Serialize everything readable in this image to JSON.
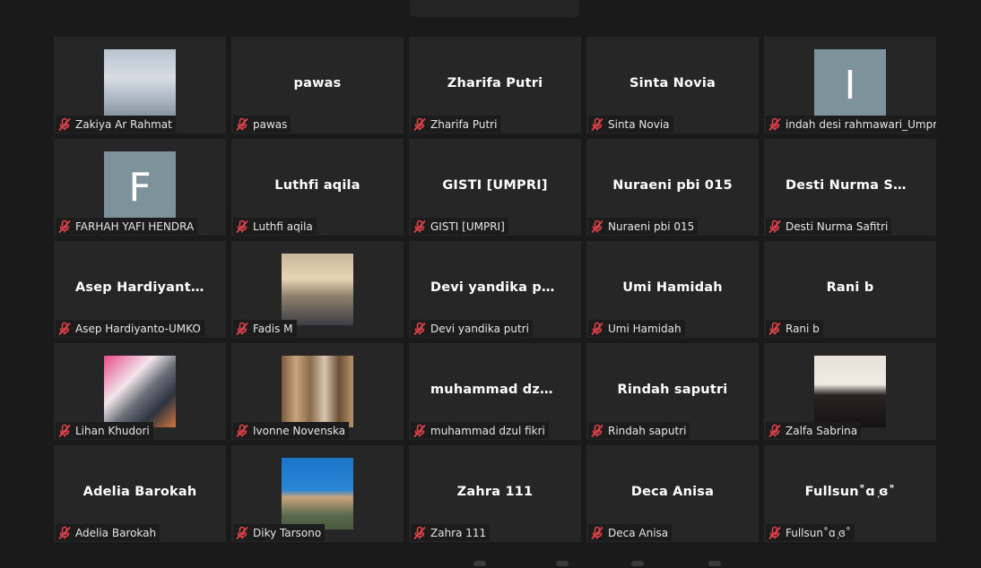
{
  "meeting": {
    "tiles": [
      {
        "display": "",
        "label": "Zakiya Ar Rahmat",
        "avatar": "photo",
        "photo": "sky"
      },
      {
        "display": "pawas",
        "label": "pawas",
        "avatar": "name"
      },
      {
        "display": "Zharifa Putri",
        "label": "Zharifa Putri",
        "avatar": "name"
      },
      {
        "display": "Sinta Novia",
        "label": "Sinta Novia",
        "avatar": "name"
      },
      {
        "display": "I",
        "label": "indah desi rahmawari_Umpri",
        "avatar": "letter"
      },
      {
        "display": "F",
        "label": "FARHAH YAFI HENDRA",
        "avatar": "letter"
      },
      {
        "display": "Luthfi aqila",
        "label": "Luthfi aqila",
        "avatar": "name"
      },
      {
        "display": "GISTI [UMPRI]",
        "label": "GISTI [UMPRI]",
        "avatar": "name"
      },
      {
        "display": "Nuraeni pbi 015",
        "label": "Nuraeni pbi 015",
        "avatar": "name"
      },
      {
        "display": "Desti  Nurma  Saf...",
        "label": "Desti Nurma Safitri",
        "avatar": "name"
      },
      {
        "display": "Asep  Hardiyant...",
        "label": "Asep Hardiyanto-UMKO",
        "avatar": "name"
      },
      {
        "display": "",
        "label": "Fadis M",
        "avatar": "photo",
        "photo": "sunset"
      },
      {
        "display": "Devi  yandika  pu...",
        "label": "Devi yandika putri",
        "avatar": "name"
      },
      {
        "display": "Umi Hamidah",
        "label": "Umi Hamidah",
        "avatar": "name"
      },
      {
        "display": "Rani b",
        "label": "Rani b",
        "avatar": "name"
      },
      {
        "display": "",
        "label": "Lihan Khudori",
        "avatar": "photo",
        "photo": "pink"
      },
      {
        "display": "",
        "label": "Ivonne Novenska",
        "avatar": "photo",
        "photo": "mirror"
      },
      {
        "display": "muhammad  dzu...",
        "label": "muhammad dzul fikri",
        "avatar": "name"
      },
      {
        "display": "Rindah saputri",
        "label": "Rindah saputri",
        "avatar": "name"
      },
      {
        "display": "",
        "label": "Zalfa Sabrina",
        "avatar": "photo",
        "photo": "hijab"
      },
      {
        "display": "Adelia Barokah",
        "label": "Adelia Barokah",
        "avatar": "name"
      },
      {
        "display": "",
        "label": "Diky Tarsono",
        "avatar": "photo",
        "photo": "official"
      },
      {
        "display": "Zahra 111",
        "label": "Zahra 111",
        "avatar": "name"
      },
      {
        "display": "Deca Anisa",
        "label": "Deca Anisa",
        "avatar": "name"
      },
      {
        "display": "Fullsun˚ɑ ᷊ɞ˚",
        "label": "Fullsun˚ɑ ᷊ɞ˚",
        "avatar": "name"
      }
    ],
    "muted_icon": "mic-muted-icon",
    "colors": {
      "background": "#1a1a1a",
      "tile": "#262626",
      "muted_red": "#e0424a",
      "letter_avatar": "#7e929c"
    }
  }
}
